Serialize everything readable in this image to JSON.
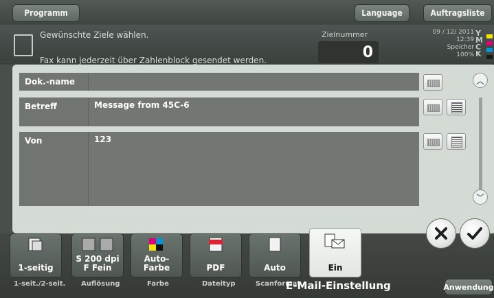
{
  "topbar": {
    "program_label": "Programm",
    "language_label": "Language",
    "jobs_label": "Auftragsliste"
  },
  "status": {
    "line1": "Gewünschte Ziele wählen.",
    "line2": "Fax kann jederzeit über Zahlenblock gesendet werden.",
    "ziel_label": "Zielnummer",
    "ziel_value": "0",
    "date": "09 / 12/ 2011",
    "time": "12:39",
    "memory_label": "Speicher",
    "memory_value": "100%",
    "toner": [
      "Y",
      "M",
      "C",
      "K"
    ],
    "toner_colors": [
      "#f2e600",
      "#e0007a",
      "#0095d9",
      "#1a1a1a"
    ]
  },
  "dialog": {
    "rows": [
      {
        "label": "Dok.-name",
        "value": ""
      },
      {
        "label": "Betreff",
        "value": "Message from 45C-6"
      },
      {
        "label": "Von",
        "value": "123"
      }
    ]
  },
  "bottom": {
    "tiles": [
      {
        "label": "1-seitig"
      },
      {
        "label": "S 200 dpi F Fein"
      },
      {
        "label": "Auto-Farbe"
      },
      {
        "label": "PDF",
        "badge": "PDF"
      },
      {
        "label": "Auto"
      },
      {
        "label": "Ein"
      }
    ],
    "captions": [
      "1-seit./2-seit.",
      "Auflösung",
      "Farbe",
      "Dateityp",
      "Scanformat"
    ],
    "email_caption": "E-Mail-Einstellung",
    "application_label": "Anwendung"
  },
  "colors": {
    "accent_purple": "#5b2c8a",
    "background": "#4a4f4c",
    "dialog": "#d4dbd4"
  }
}
